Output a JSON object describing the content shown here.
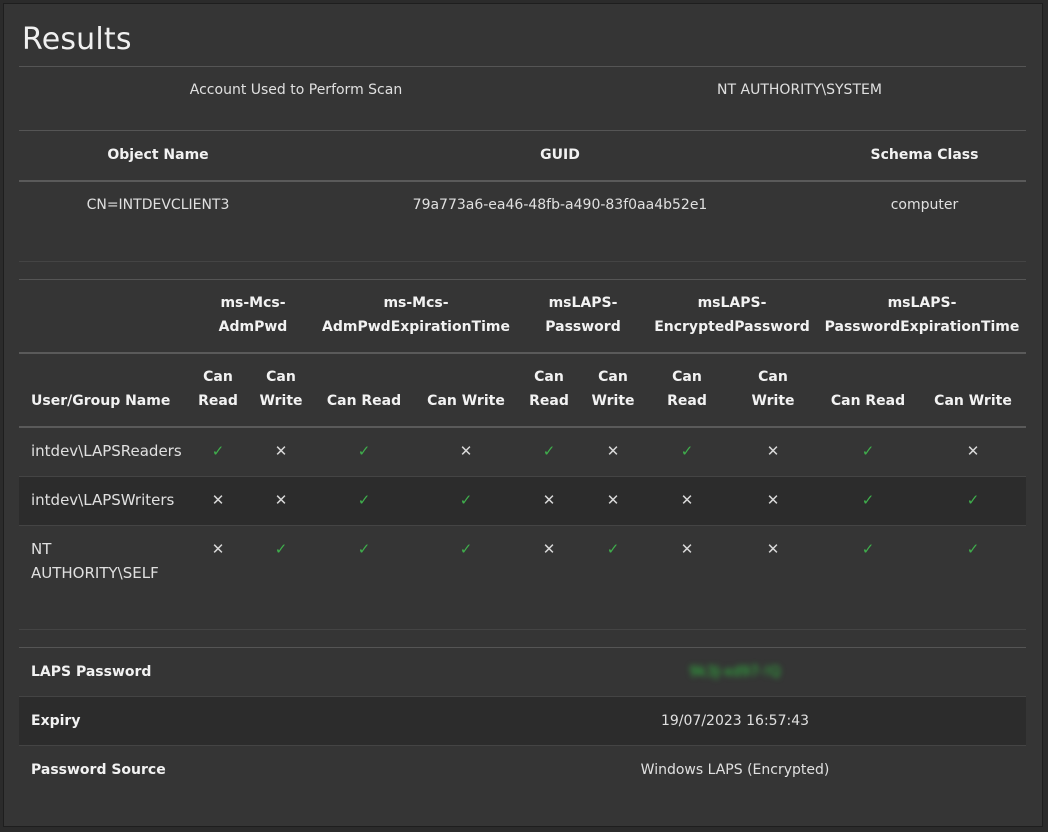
{
  "title": "Results",
  "scan": {
    "label": "Account Used to Perform Scan",
    "value": "NT AUTHORITY\\SYSTEM"
  },
  "object_table": {
    "headers": [
      "Object Name",
      "GUID",
      "Schema Class"
    ],
    "row": [
      "CN=INTDEVCLIENT3",
      "79a773a6-ea46-48fb-a490-83f0aa4b52e1",
      "computer"
    ]
  },
  "perm_table": {
    "attr_headers": [
      [
        "ms-Mcs-",
        "AdmPwd"
      ],
      [
        "ms-Mcs-",
        "AdmPwdExpirationTime"
      ],
      [
        "msLAPS-",
        "Password"
      ],
      [
        "msLAPS-",
        "EncryptedPassword"
      ],
      [
        "msLAPS-",
        "PasswordExpirationTime"
      ]
    ],
    "user_header": "User/Group Name",
    "sub_headers": [
      [
        "Can",
        "Read"
      ],
      [
        "Can",
        "Write"
      ],
      [
        "Can Read"
      ],
      [
        "Can Write"
      ],
      [
        "Can",
        "Read"
      ],
      [
        "Can",
        "Write"
      ],
      [
        "Can",
        "Read"
      ],
      [
        "Can",
        "Write"
      ],
      [
        "Can Read"
      ],
      [
        "Can Write"
      ]
    ],
    "rows": [
      {
        "name": [
          "intdev\\LAPSReaders"
        ],
        "perms": [
          true,
          false,
          true,
          false,
          true,
          false,
          true,
          false,
          true,
          false
        ]
      },
      {
        "name": [
          "intdev\\LAPSWriters"
        ],
        "perms": [
          false,
          false,
          true,
          true,
          false,
          false,
          false,
          false,
          true,
          true
        ]
      },
      {
        "name": [
          "NT",
          "AUTHORITY\\SELF"
        ],
        "perms": [
          false,
          true,
          true,
          true,
          false,
          true,
          false,
          false,
          true,
          true
        ]
      }
    ]
  },
  "check_glyph": "✓",
  "cross_glyph": "✕",
  "details": [
    {
      "label": "LAPS Password",
      "value": "9k3J-xd97-!Q"
    },
    {
      "label": "Expiry",
      "value": "19/07/2023 16:57:43"
    },
    {
      "label": "Password Source",
      "value": "Windows LAPS (Encrypted)"
    }
  ],
  "colors": {
    "check": "#3fae4c",
    "stripe": "#2c2c2c",
    "background": "#353535"
  }
}
